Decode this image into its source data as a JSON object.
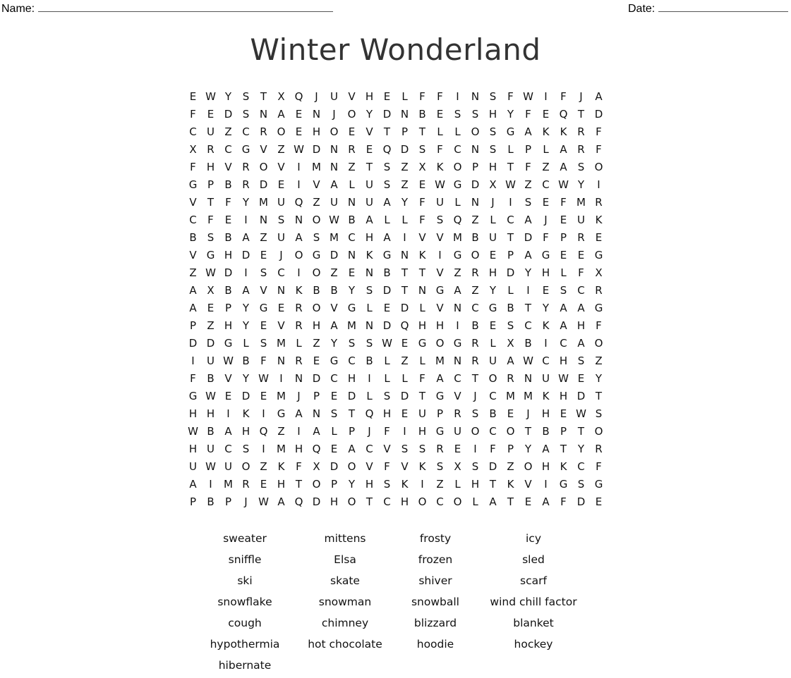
{
  "header": {
    "name_label": "Name:",
    "date_label": "Date:"
  },
  "title": "Winter Wonderland",
  "grid": [
    "EWYSTXQJUVHELFFINSFWIFJA",
    "FEDSNAENJOYDNBESSHYFEQTD",
    "CUZCROEHOEVTPTLLOSGAKKRF",
    "XRCGVZWDNREQDSFCNSLPLARF",
    "FHVROVIMNZTSZXKOPHTFZASO",
    "GPBRDEIVALUSZEWGDXWZCWYI",
    "VTFYMUQZUNUAYFULNJISEFMR",
    "CFEINSNOWBALLFSQZLCAJEUK",
    "BSBAZUASMCHAIVVMBUTDFPRE",
    "VGHDEJOGDNKGNKIGOEPAGEEG",
    "ZWDISCIOZENBTTVZRHDYHLFX",
    "AXBAVNKBBYSDTNGAZYLIESCR",
    "AEPYGEROVGLEDLVNCGBTYAAG",
    "PZHYEVRHAMNDQHHIBESCKAHF",
    "DDGLSMLZYSSWEGOGRLXBICAO",
    "IUWBFNREGCBLZLMNRUAWCHSZ",
    "FBVYWINDCHILLFACTORNUWEY",
    "GWEDEMJPEDLSDTGVJCMMKHDT",
    "HHIKIGANSTQHEUPRSBEJHEWS",
    "WBAHQZIALPJFIHGUOCOTBPTO",
    "HUCSIMHQEACVSSREIFPYATYR",
    "UWUOZKFXDOVFVKSXSDZOHKCF",
    "AIMREHTOPYHSKIZLHTKVIGSG",
    "PBPJWAQDHOTCHOCOLATEAFDE"
  ],
  "word_bank": [
    "sweater",
    "mittens",
    "frosty",
    "icy",
    "sniffle",
    "Elsa",
    "frozen",
    "sled",
    "ski",
    "skate",
    "shiver",
    "scarf",
    "snowflake",
    "snowman",
    "snowball",
    "wind chill factor",
    "cough",
    "chimney",
    "blizzard",
    "blanket",
    "hypothermia",
    "hot chocolate",
    "hoodie",
    "hockey",
    "hibernate"
  ]
}
